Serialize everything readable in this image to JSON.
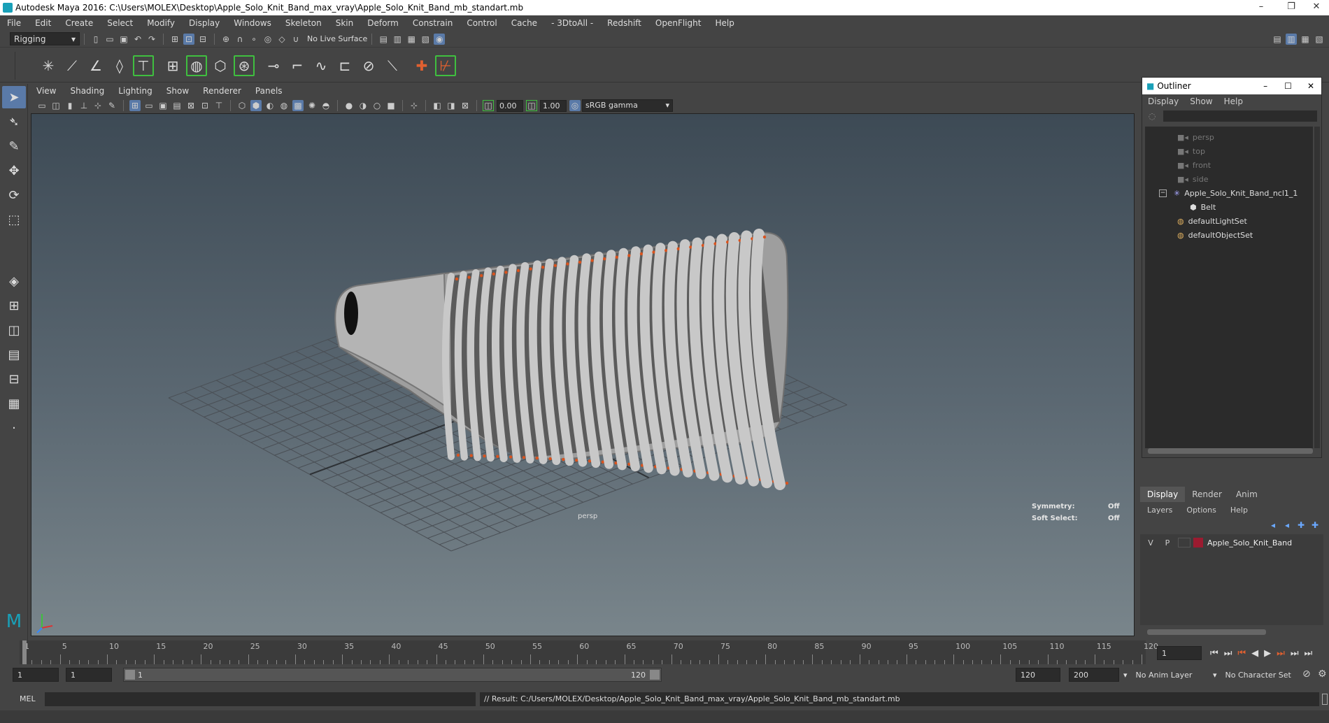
{
  "window": {
    "title": "Autodesk Maya 2016: C:\\Users\\MOLEX\\Desktop\\Apple_Solo_Knit_Band_max_vray\\Apple_Solo_Knit_Band_mb_standart.mb",
    "minimize": "–",
    "maximize": "❐",
    "close": "✕"
  },
  "menubar": [
    "File",
    "Edit",
    "Create",
    "Select",
    "Modify",
    "Display",
    "Windows",
    "Skeleton",
    "Skin",
    "Deform",
    "Constrain",
    "Control",
    "Cache",
    "- 3DtoAll -",
    "Redshift",
    "OpenFlight",
    "Help"
  ],
  "statusline": {
    "mode": "Rigging",
    "live_surface": "No Live Surface"
  },
  "viewport": {
    "menu": [
      "View",
      "Shading",
      "Lighting",
      "Show",
      "Renderer",
      "Panels"
    ],
    "near_value": "0.00",
    "far_value": "1.00",
    "color_space": "sRGB gamma",
    "camera_label": "persp",
    "hud": {
      "symmetry_label": "Symmetry:",
      "symmetry_value": "Off",
      "soft_select_label": "Soft Select:",
      "soft_select_value": "Off"
    }
  },
  "outliner": {
    "title": "Outliner",
    "menu": [
      "Display",
      "Show",
      "Help"
    ],
    "items": [
      {
        "label": "persp",
        "icon": "camera-icon",
        "dim": true
      },
      {
        "label": "top",
        "icon": "camera-icon",
        "dim": true
      },
      {
        "label": "front",
        "icon": "camera-icon",
        "dim": true
      },
      {
        "label": "side",
        "icon": "camera-icon",
        "dim": true
      },
      {
        "label": "Apple_Solo_Knit_Band_ncl1_1",
        "icon": "group-icon",
        "dim": false
      },
      {
        "label": "Belt",
        "icon": "mesh-icon",
        "dim": false
      },
      {
        "label": "defaultLightSet",
        "icon": "set-icon",
        "dim": false
      },
      {
        "label": "defaultObjectSet",
        "icon": "set-icon",
        "dim": false
      }
    ]
  },
  "layer_editor": {
    "tabs": [
      "Display",
      "Render",
      "Anim"
    ],
    "menu": [
      "Layers",
      "Options",
      "Help"
    ],
    "layer": {
      "v": "V",
      "p": "P",
      "name": "Apple_Solo_Knit_Band",
      "color": "#9b1b30"
    }
  },
  "timeline": {
    "ticks": [
      "1",
      "5",
      "10",
      "15",
      "20",
      "25",
      "30",
      "35",
      "40",
      "45",
      "50",
      "55",
      "60",
      "65",
      "70",
      "75",
      "80",
      "85",
      "90",
      "95",
      "100",
      "105",
      "110",
      "115",
      "120"
    ],
    "current_frame": "1"
  },
  "range": {
    "start": "1",
    "start_inner": "1",
    "slider_start": "1",
    "slider_end": "120",
    "end_inner": "120",
    "end": "200",
    "anim_layer": "No Anim Layer",
    "character_set": "No Character Set"
  },
  "command": {
    "lang": "MEL",
    "result": "// Result: C:/Users/MOLEX/Desktop/Apple_Solo_Knit_Band_max_vray/Apple_Solo_Knit_Band_mb_standart.mb"
  },
  "colors": {
    "accent": "#5a7aa8",
    "shelf_highlight": "#3fbf3f",
    "knit_orange": "#d9531e"
  }
}
